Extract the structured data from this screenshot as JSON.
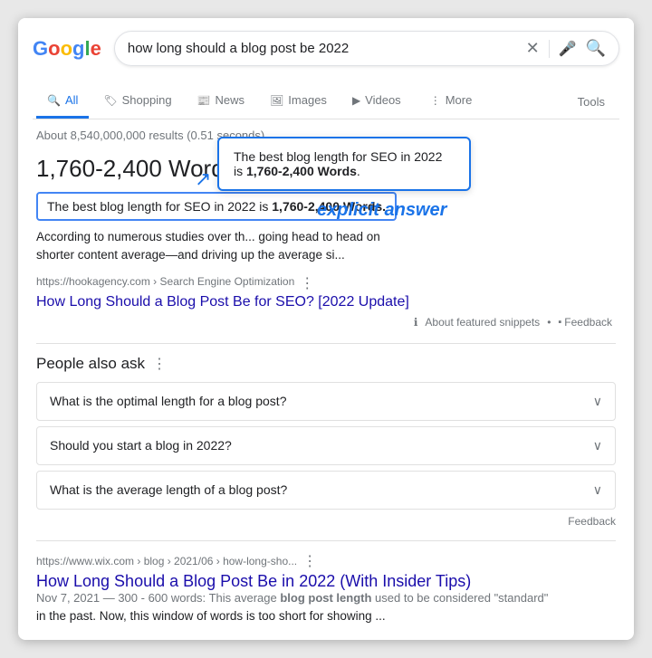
{
  "logo": {
    "text": "Google",
    "letters": [
      "G",
      "o",
      "o",
      "g",
      "l",
      "e"
    ]
  },
  "search": {
    "query": "how long should a blog post be 2022",
    "placeholder": "Search"
  },
  "nav": {
    "tabs": [
      {
        "id": "all",
        "label": "All",
        "icon": "🔍",
        "active": true
      },
      {
        "id": "shopping",
        "label": "Shopping",
        "icon": "🏷"
      },
      {
        "id": "news",
        "label": "News",
        "icon": "📰"
      },
      {
        "id": "images",
        "label": "Images",
        "icon": "🖼"
      },
      {
        "id": "videos",
        "label": "Videos",
        "icon": "▶"
      },
      {
        "id": "more",
        "label": "More",
        "icon": "⋮"
      }
    ],
    "tools_label": "Tools"
  },
  "results_count": "About 8,540,000,000 results (0.51 seconds)",
  "featured_snippet": {
    "answer_heading": "1,760-2,400 Words",
    "snippet_highlight": "The best blog length for SEO in 2022 is 1,760-2,400 Words.",
    "snippet_text": "According to numerous studies over th... going head to head on shorter content average—and driving up the average si...",
    "url_display": "https://hookagency.com › Search Engine Optimization",
    "link_text": "How Long Should a Blog Post Be for SEO? [2022 Update]",
    "footer_about": "About featured snippets",
    "footer_feedback": "Feedback"
  },
  "callout": {
    "text_before": "The best blog length for SEO in 2022 is ",
    "text_bold": "1,760-2,400 Words",
    "text_after": ".",
    "label": "explicit answer"
  },
  "paa": {
    "heading": "People also ask",
    "items": [
      "What is the optimal length for a blog post?",
      "Should you start a blog in 2022?",
      "What is the average length of a blog post?"
    ],
    "feedback_label": "Feedback"
  },
  "second_result": {
    "url_display": "https://www.wix.com › blog › 2021/06 › how-long-sho...",
    "title": "How Long Should a Blog Post Be in 2022 (With Insider Tips)",
    "date_range": "Nov 7, 2021 — 300 - 600 words:",
    "snippet_text": "This average blog post length used to be considered \"standard\" in the past. Now, this window of words is too short for showing ..."
  }
}
